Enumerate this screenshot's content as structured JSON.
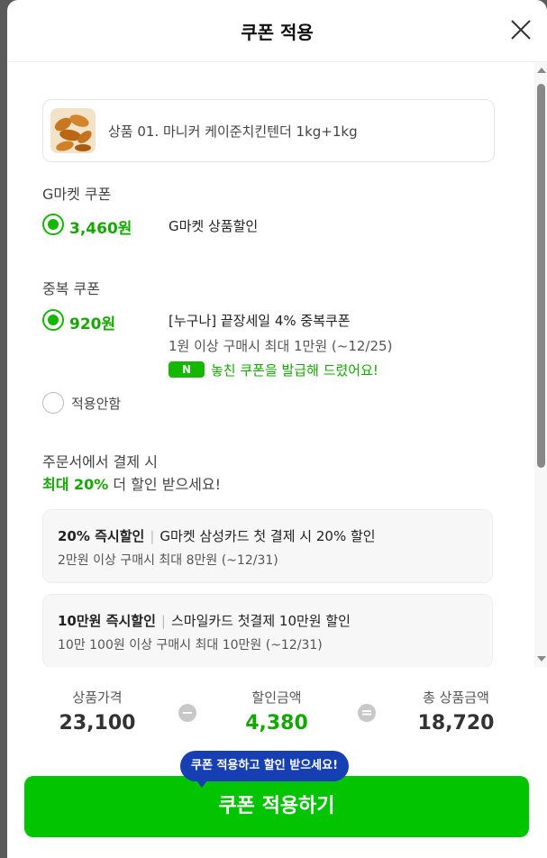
{
  "modal": {
    "title": "쿠폰 적용"
  },
  "product": {
    "name": "상품 01. 마니커 케이준치킨텐더 1kg+1kg"
  },
  "gmarket_coupon": {
    "section_label": "G마켓 쿠폰",
    "amount": "3,460원",
    "description": "G마켓 상품할인"
  },
  "duplicate_coupon": {
    "section_label": "중복 쿠폰",
    "amount": "920원",
    "description": "[누구나] 끝장세일 4% 중복쿠폰",
    "condition": "1원 이상 구매시 최대 1만원 (~12/25)",
    "badge": "N",
    "notice": "놓친 쿠폰을 발급해 드렸어요!",
    "none_label": "적용안함"
  },
  "promo": {
    "line1": "주문서에서 결제 시",
    "highlight": "최대 20%",
    "line2_rest": " 더 할인 받으세요!",
    "cards": [
      {
        "title": "20% 즉시할인",
        "desc": "G마켓 삼성카드 첫 결제 시 20% 할인",
        "condition": "2만원 이상 구매시 최대 8만원 (~12/31)"
      },
      {
        "title": "10만원 즉시할인",
        "desc": "스마일카드 첫결제 10만원 할인",
        "condition": "10만 100원 이상 구매시 최대 10만원 (~12/31)"
      }
    ]
  },
  "summary": {
    "price_label": "상품가격",
    "price": "23,100",
    "minus": "−",
    "discount_label": "할인금액",
    "discount": "4,380",
    "equals": "=",
    "total_label": "총 상품금액",
    "total": "18,720"
  },
  "tooltip": "쿠폰 적용하고 할인 받으세요!",
  "apply_button": "쿠폰 적용하기",
  "colors": {
    "accent_green": "#02c400",
    "tooltip_blue": "#173fb4"
  }
}
